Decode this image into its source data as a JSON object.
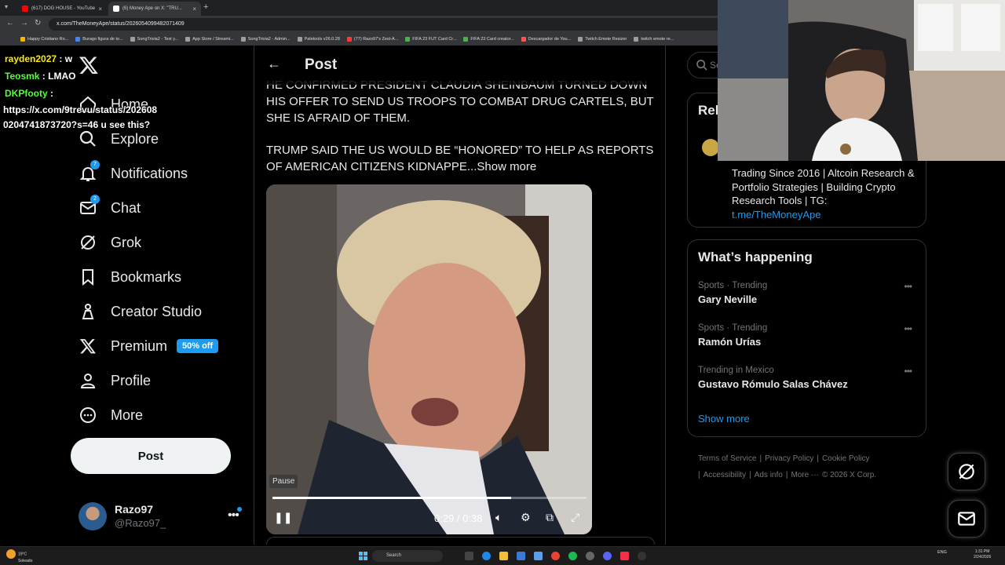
{
  "browser": {
    "tabs": [
      {
        "label": "(617) DOG HOUSE - YouTube",
        "color": "#ff0000"
      },
      {
        "label": "(6) Money Ape on X: \"TRU...",
        "color": "#ffffff"
      }
    ],
    "url": "x.com/TheMoneyApe/status/2026054099482071409",
    "bookmarks": [
      "Happy Cristiano Ro...",
      "Burago figura de to...",
      "SongTrivia2 - Test y...",
      "App Store / Streami...",
      "SongTrivia2 - Admin...",
      "Paletools v26.0.28",
      "(77) Razo97's Zest-A...",
      "FIFA 23 FUT Card Cr...",
      "FIFA 23 Card creator...",
      "Descargador de You...",
      "Twitch Emote Resizer",
      "twitch emote re..."
    ]
  },
  "chat": [
    {
      "user": "rayden2027",
      "msg": " : w",
      "color": "yellow"
    },
    {
      "user": "Teosmk",
      "msg": " : LMAO",
      "color": "green"
    },
    {
      "user": "DKPfooty",
      "msg": " :",
      "color": "green"
    }
  ],
  "chat_url": "https://x.com/9trevu/status/202608 0204741873720?s=46 u see this?",
  "sidebar": {
    "items": [
      {
        "label": "Home",
        "icon": "home-icon"
      },
      {
        "label": "Explore",
        "icon": "search-icon"
      },
      {
        "label": "Notifications",
        "icon": "bell-icon",
        "badge": "7"
      },
      {
        "label": "Chat",
        "icon": "mail-icon",
        "badge": "2"
      },
      {
        "label": "Grok",
        "icon": "grok-icon"
      },
      {
        "label": "Bookmarks",
        "icon": "bookmark-icon"
      },
      {
        "label": "Creator Studio",
        "icon": "creator-studio-icon"
      },
      {
        "label": "Premium",
        "icon": "x-premium-icon"
      },
      {
        "label": "Profile",
        "icon": "profile-icon"
      },
      {
        "label": "More",
        "icon": "more-icon"
      }
    ],
    "premium_badge": "50% off",
    "post_label": "Post",
    "account": {
      "name": "Razo97",
      "handle": "@Razo97_"
    }
  },
  "main": {
    "title": "Post",
    "paragraphs": [
      "HE CONFIRMED PRESIDENT CLAUDIA SHEINBAUM TURNED DOWN HIS OFFER TO SEND US TROOPS TO COMBAT DRUG CARTELS, BUT SHE IS AFRAID OF THEM.",
      "TRUMP SAID THE US WOULD BE “HONORED” TO HELP AS REPORTS OF AMERICAN CITIZENS KIDNAPPE..."
    ],
    "show_more": "Show more",
    "video": {
      "tooltip": "Pause",
      "time": "0:29 / 0:38",
      "progress": 0.76
    }
  },
  "right": {
    "search_placeholder": "Se",
    "relevant_title": "Rele",
    "relevant_bio": "Trading Since 2016 | Altcoin Research & Portfolio Strategies | Building Crypto Research Tools | TG:",
    "relevant_link": "t.me/TheMoneyApe",
    "whats_happening": "What’s happening",
    "trends": [
      {
        "category": "Sports · Trending",
        "name": "Gary Neville"
      },
      {
        "category": "Sports · Trending",
        "name": "Ramón Urías"
      },
      {
        "category": "Trending in Mexico",
        "name": "Gustavo Rómulo Salas Chávez"
      }
    ],
    "show_more": "Show more",
    "footer": [
      "Terms of Service",
      "|",
      "Privacy Policy",
      "|",
      "Cookie Policy",
      "|",
      "Accessibility",
      "|",
      "Ads info",
      "|",
      "More ···",
      "© 2026 X Corp."
    ]
  },
  "taskbar": {
    "weather_temp": "19°C",
    "weather_desc": "Soleado",
    "search": "Search",
    "lang": "ENG",
    "time": "1:31 PM",
    "date": "2/24/2026"
  }
}
